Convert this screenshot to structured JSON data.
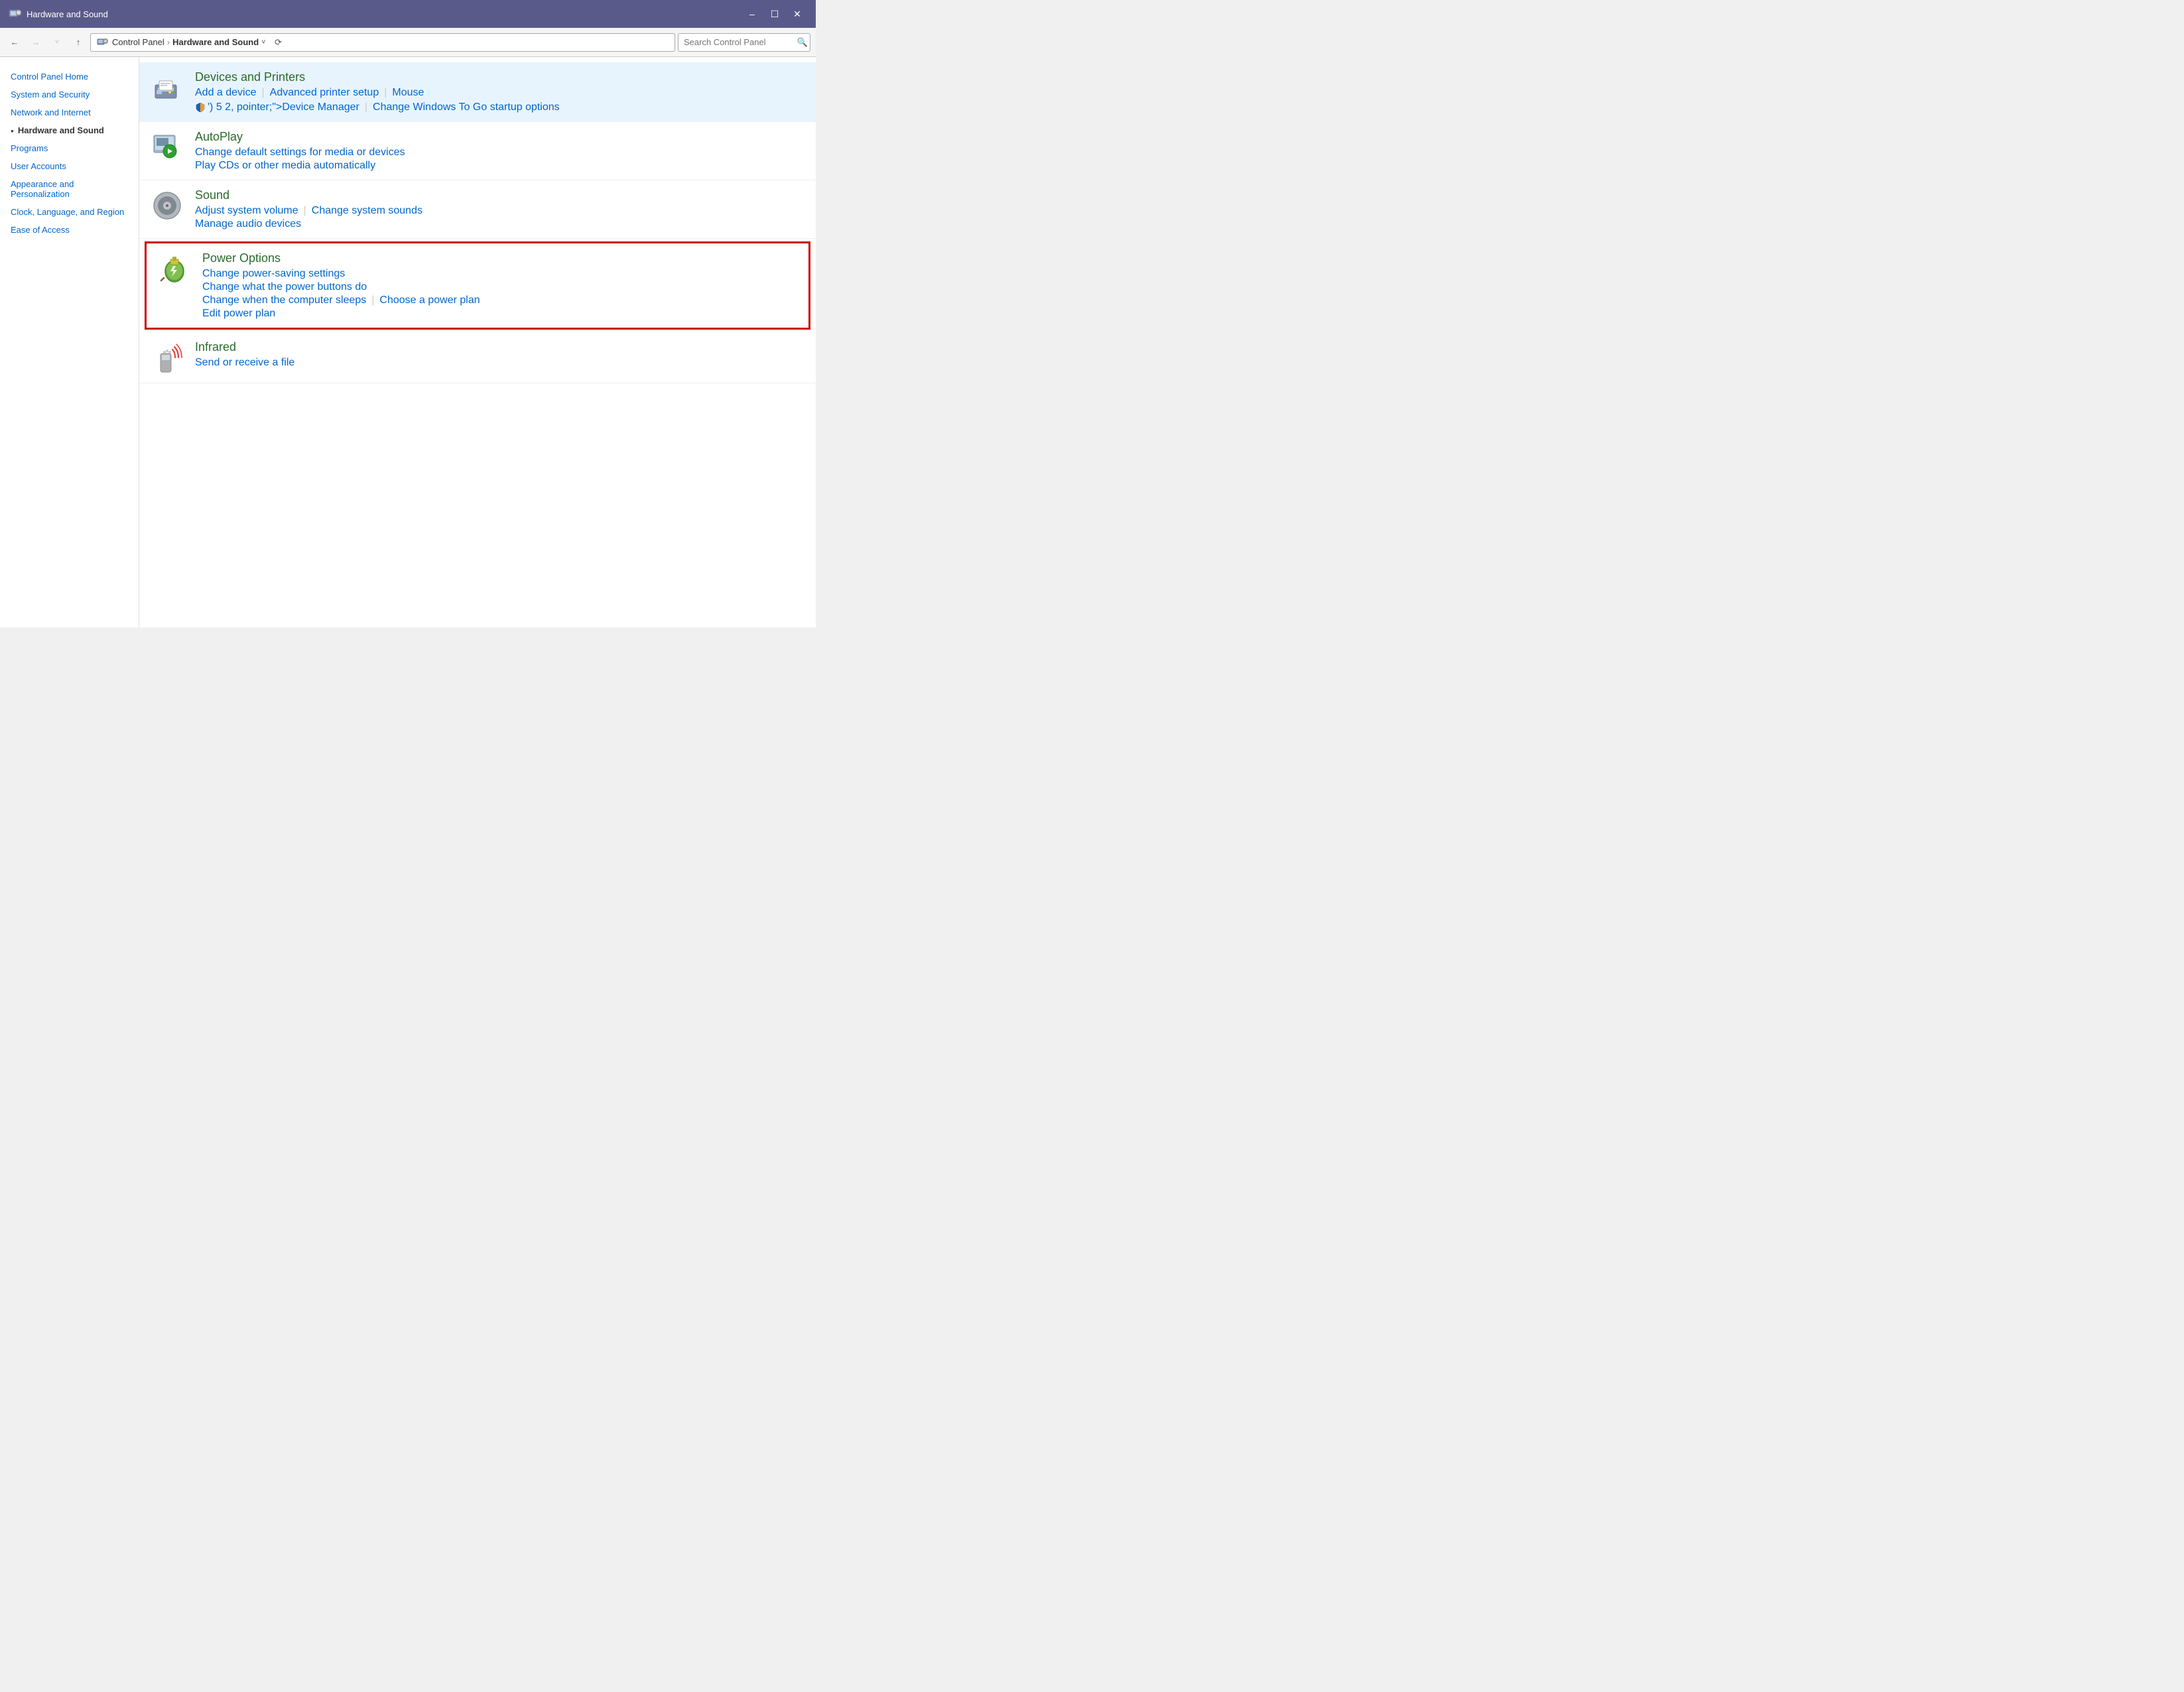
{
  "titlebar": {
    "title": "Hardware and Sound",
    "min_label": "–",
    "max_label": "☐",
    "close_label": "✕"
  },
  "addressbar": {
    "back_label": "←",
    "forward_label": "→",
    "dropdown_label": "˅",
    "up_label": "↑",
    "path_parts": [
      "Control Panel",
      "Hardware and Sound"
    ],
    "refresh_label": "⟳",
    "search_placeholder": "Search Control Panel",
    "search_icon_label": "🔍"
  },
  "sidebar": {
    "items": [
      {
        "label": "Control Panel Home",
        "active": false
      },
      {
        "label": "System and Security",
        "active": false
      },
      {
        "label": "Network and Internet",
        "active": false
      },
      {
        "label": "Hardware and Sound",
        "active": true
      },
      {
        "label": "Programs",
        "active": false
      },
      {
        "label": "User Accounts",
        "active": false
      },
      {
        "label": "Appearance and Personalization",
        "active": false
      },
      {
        "label": "Clock, Language, and Region",
        "active": false
      },
      {
        "label": "Ease of Access",
        "active": false
      }
    ]
  },
  "sections": [
    {
      "id": "devices-printers",
      "title": "Devices and Printers",
      "highlighted": true,
      "boxed": false,
      "links_row1": [
        "Add a device",
        "Advanced printer setup",
        "Mouse"
      ],
      "links_row2": [
        "Device Manager",
        "Change Windows To Go startup options"
      ],
      "row2_has_shield": true
    },
    {
      "id": "autoplay",
      "title": "AutoPlay",
      "highlighted": false,
      "boxed": false,
      "links_row1": [
        "Change default settings for media or devices"
      ],
      "links_row2": [
        "Play CDs or other media automatically"
      ]
    },
    {
      "id": "sound",
      "title": "Sound",
      "highlighted": false,
      "boxed": false,
      "links_row1": [
        "Adjust system volume",
        "Change system sounds"
      ],
      "links_row2": [
        "Manage audio devices"
      ]
    },
    {
      "id": "power-options",
      "title": "Power Options",
      "highlighted": false,
      "boxed": true,
      "links_row1": [
        "Change power-saving settings"
      ],
      "links_row2": [
        "Change what the power buttons do"
      ],
      "links_row3": [
        "Change when the computer sleeps",
        "Choose a power plan"
      ],
      "links_row4": [
        "Edit power plan"
      ]
    },
    {
      "id": "infrared",
      "title": "Infrared",
      "highlighted": false,
      "boxed": false,
      "links_row1": [
        "Send or receive a file"
      ]
    }
  ]
}
